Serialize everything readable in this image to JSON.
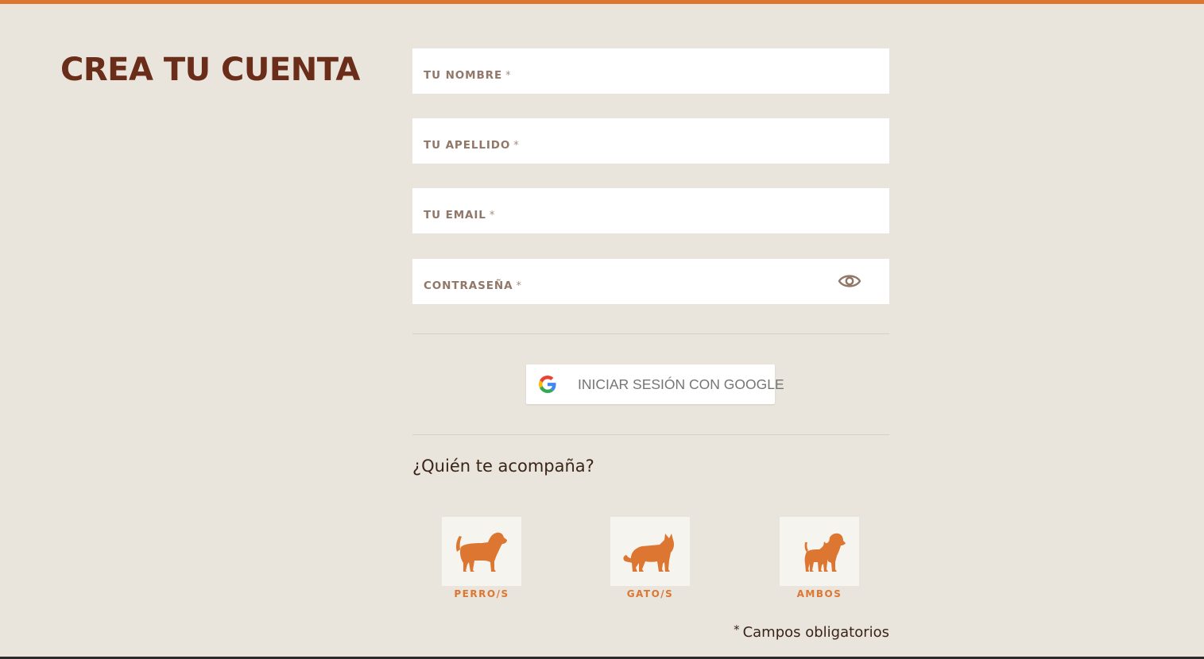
{
  "page": {
    "title": "CREA TU CUENTA",
    "accent_color": "#dc7631",
    "title_color": "#6a2d19",
    "background_color": "#eae5dc"
  },
  "form": {
    "required_mark": "*",
    "fields": [
      {
        "label": "TU NOMBRE",
        "value": ""
      },
      {
        "label": "TU APELLIDO",
        "value": ""
      },
      {
        "label": "TU EMAIL",
        "value": ""
      },
      {
        "label": "CONTRASEÑA",
        "value": "",
        "icon": "eye-icon"
      }
    ],
    "google_button": {
      "label": "INICIAR SESIÓN CON GOOGLE",
      "icon": "google-icon"
    },
    "companion_question": "¿Quién te acompaña?",
    "pets": [
      {
        "label": "PERRO/S",
        "icon": "dog-icon"
      },
      {
        "label": "GATO/S",
        "icon": "cat-icon"
      },
      {
        "label": "AMBOS",
        "icon": "dog-and-cat-icon"
      }
    ],
    "required_note": "Campos obligatorios"
  }
}
